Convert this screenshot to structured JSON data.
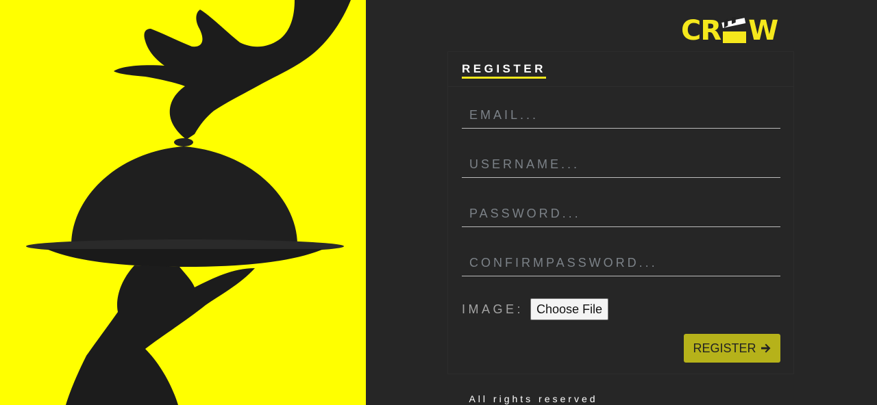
{
  "brand": {
    "logo_text_left": "CR",
    "logo_text_right": "W",
    "logo_color": "#f5e81c",
    "hero_background": "#ffff00"
  },
  "form": {
    "title": "REGISTER",
    "email_placeholder": "EMAIL...",
    "username_placeholder": "USERNAME...",
    "password_placeholder": "PASSWORD...",
    "confirm_password_placeholder": "CONFIRMPASSWORD...",
    "image_label": "IMAGE:",
    "choose_file_label": "Choose File",
    "submit_label": "REGISTER",
    "submit_icon": "arrow-right-icon",
    "accent_color": "#b6b21a"
  },
  "footer": {
    "text": "All rights reserved"
  }
}
